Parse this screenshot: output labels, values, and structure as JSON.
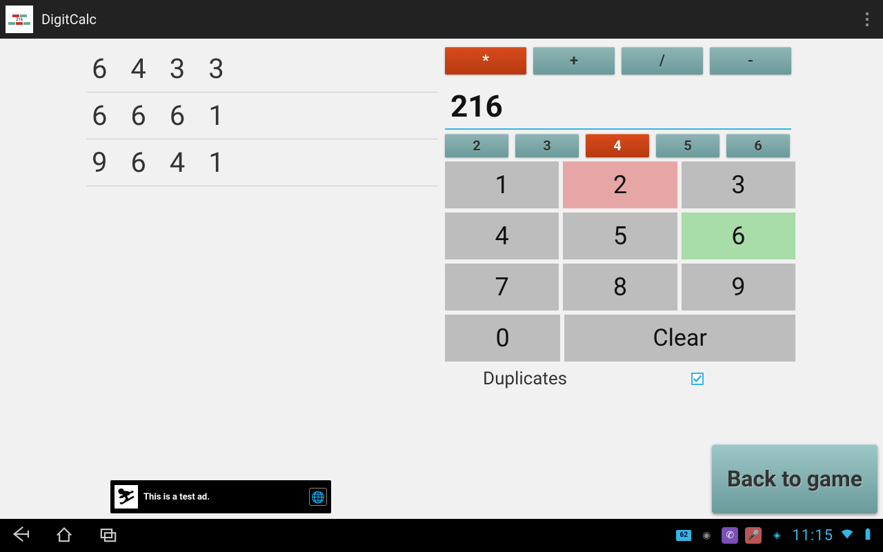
{
  "app": {
    "title": "DigitCalc"
  },
  "history": [
    "6 4 3 3",
    "6 6 6 1",
    "9 6 4 1"
  ],
  "operators": [
    {
      "label": "*",
      "active": true
    },
    {
      "label": "+",
      "active": false
    },
    {
      "label": "/",
      "active": false
    },
    {
      "label": "-",
      "active": false
    }
  ],
  "display": "216",
  "tabs": [
    {
      "label": "2",
      "active": false
    },
    {
      "label": "3",
      "active": false
    },
    {
      "label": "4",
      "active": true
    },
    {
      "label": "5",
      "active": false
    },
    {
      "label": "6",
      "active": false
    }
  ],
  "keypad": {
    "k1": "1",
    "k2": "2",
    "k3": "3",
    "k4": "4",
    "k5": "5",
    "k6": "6",
    "k7": "7",
    "k8": "8",
    "k9": "9",
    "k0": "0",
    "clear": "Clear"
  },
  "duplicates": {
    "label": "Duplicates",
    "checked": true
  },
  "back_label": "Back to game",
  "ad": {
    "text": "This is a test ad."
  },
  "status": {
    "battery_pct": "62",
    "time": "11:15"
  }
}
